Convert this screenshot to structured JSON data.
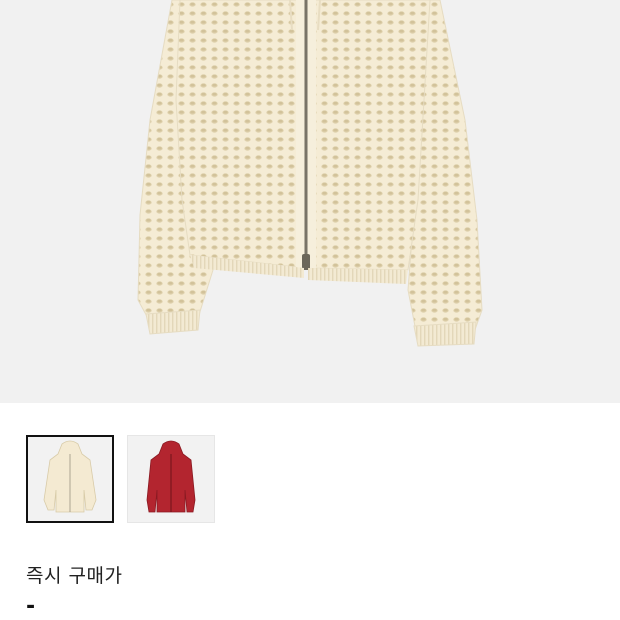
{
  "product": {
    "main_image": "cream-open-knit-zip-hoodie",
    "thumbnails": [
      {
        "name": "cream-zip-hoodie-thumb",
        "selected": true,
        "color": "#f4ead2"
      },
      {
        "name": "red-zip-hoodie-thumb",
        "selected": false,
        "color": "#b3252f"
      }
    ]
  },
  "price": {
    "label": "즉시 구매가",
    "value": "-"
  },
  "colors": {
    "hero_background": "#f1f1f1",
    "knit_cream": "#f4ead2",
    "knit_red": "#b3252f",
    "selected_border": "#111111"
  }
}
